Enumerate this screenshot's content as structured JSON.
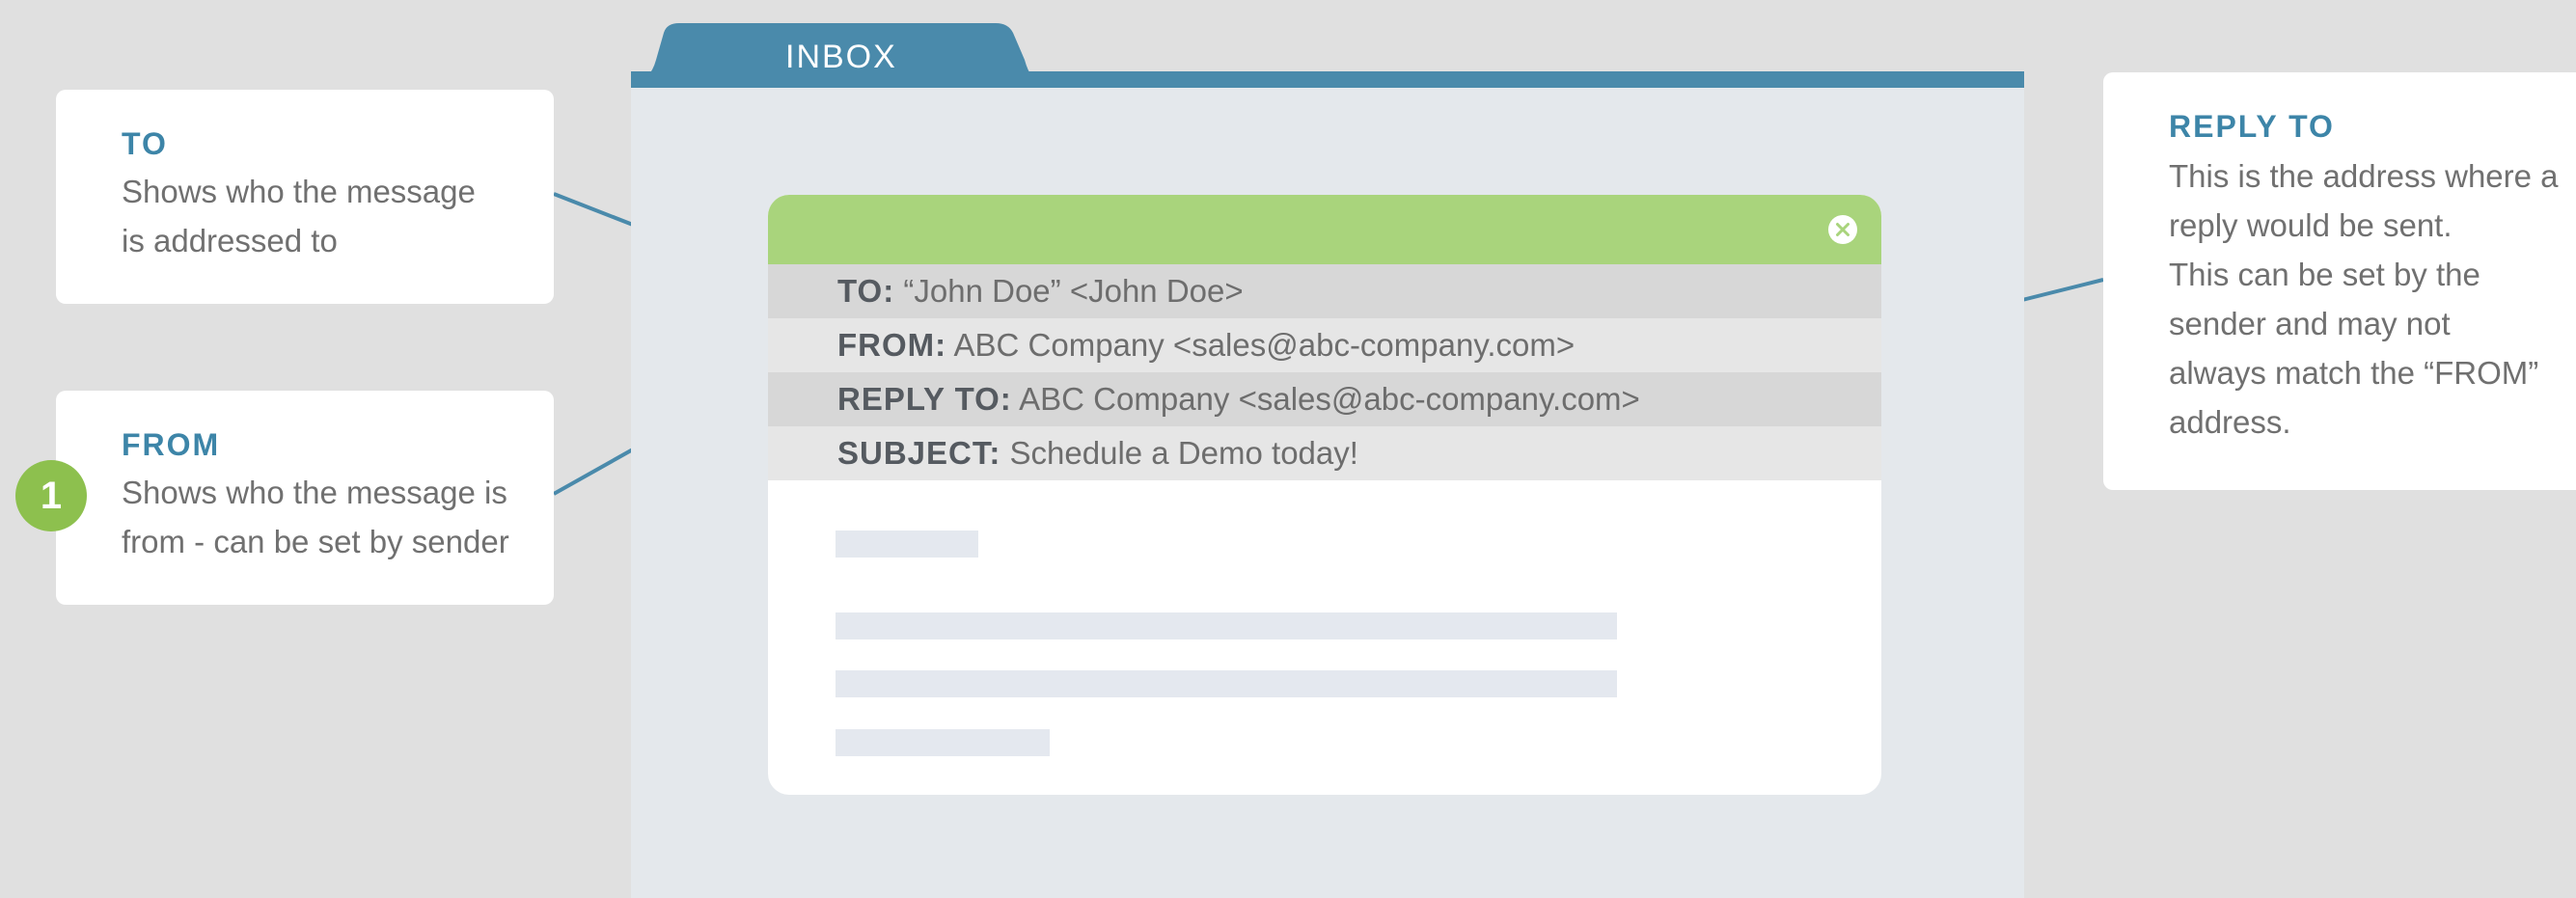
{
  "folder": {
    "tab_label": "INBOX"
  },
  "email": {
    "rows": [
      {
        "label": "TO:",
        "value": "“John Doe” <John Doe>"
      },
      {
        "label": "FROM:",
        "value": "ABC Company <sales@abc-company.com>"
      },
      {
        "label": "REPLY TO:",
        "value": "ABC Company <sales@abc-company.com>"
      },
      {
        "label": "SUBJECT:",
        "value": "Schedule a Demo today!"
      }
    ]
  },
  "callouts": {
    "to": {
      "title": "TO",
      "description": "Shows who the message\nis addressed to"
    },
    "from": {
      "title": "FROM",
      "description": "Shows who the message is\nfrom - can be set by sender",
      "badge": "1"
    },
    "reply_to": {
      "title": "REPLY TO",
      "description": "This is the address where a\nreply would be sent.\nThis can be set by the\nsender and may not\nalways match the “FROM”\naddress."
    }
  },
  "colors": {
    "background": "#e0e0e0",
    "folder_accent": "#4a8aab",
    "folder_body": "#e4e8ec",
    "email_header": "#a9d47c",
    "badge": "#8dc04e",
    "callout_title": "#3d85a8",
    "connector": "#4a8aab"
  },
  "icons": {
    "close": "close-circle-icon"
  }
}
